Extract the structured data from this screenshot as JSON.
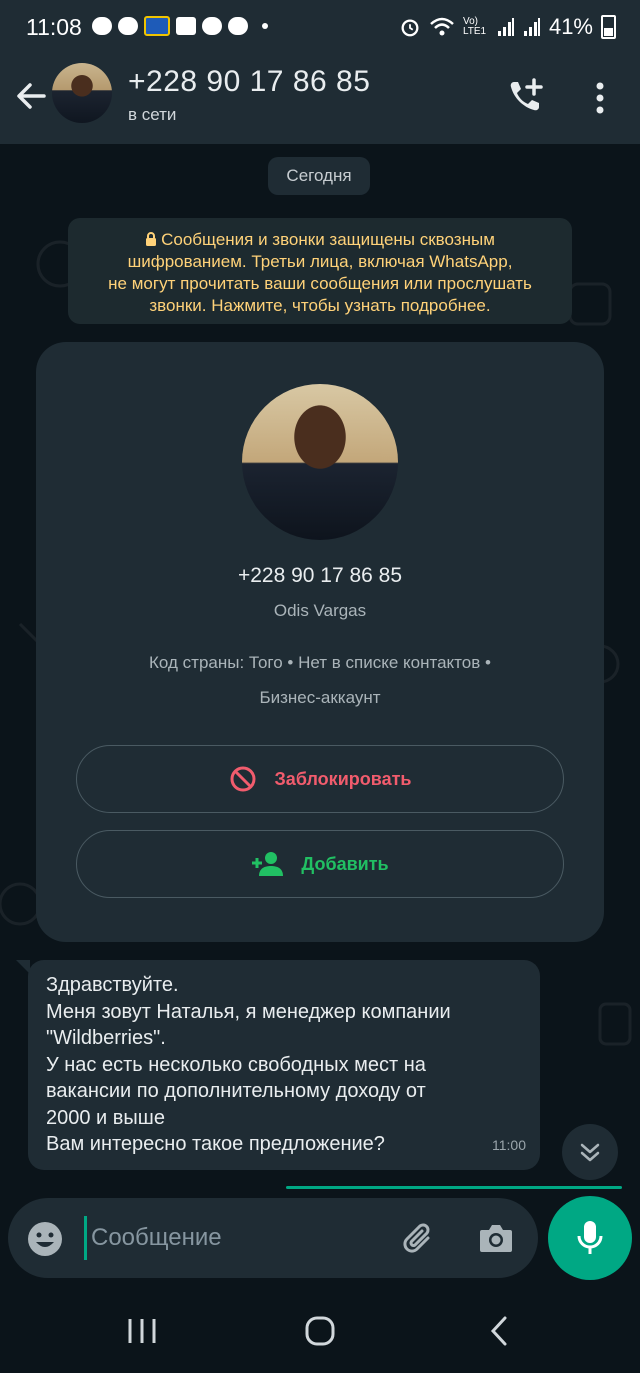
{
  "status_bar": {
    "time": "11:08",
    "battery": "41%",
    "network": "Vo) LTE1",
    "left_icons": [
      "chat-bubble-icon",
      "hh-icon",
      "metro-icon",
      "shopping-bag-icon",
      "cloud-icon",
      "bird-icon",
      "dot-icon"
    ],
    "right_icons": [
      "alarm-icon",
      "wifi-icon",
      "signal-icon",
      "signal-icon",
      "battery-icon"
    ]
  },
  "header": {
    "title": "+228 90 17 86 85",
    "status": "в сети",
    "icons": [
      "back-arrow-icon",
      "add-call-icon",
      "more-vert-icon"
    ]
  },
  "chat": {
    "date_label": "Сегодня",
    "e2e_notice": {
      "lines": [
        "Сообщения и звонки защищены сквозным",
        "шифрованием. Третьи лица, включая WhatsApp,",
        "не могут прочитать ваши сообщения или прослушать",
        "звонки. Нажмите, чтобы узнать подробнее."
      ],
      "icon": "lock-icon"
    },
    "contact_card": {
      "phone": "+228 90 17 86 85",
      "name": "Odis Vargas",
      "info_line1": "Код страны: Того • Нет в списке контактов •",
      "info_line2": "Бизнес-аккаунт",
      "block_label": "Заблокировать",
      "add_label": "Добавить"
    },
    "message": {
      "lines": [
        "Здравствуйте.",
        "Меня зовут Наталья, я менеджер компании",
        "\"Wildberries\".",
        "У нас есть несколько свободных мест на",
        "вакансии по дополнительному доходу от",
        "2000 и выше",
        "Вам интересно такое предложение?"
      ],
      "time": "11:00"
    }
  },
  "input": {
    "placeholder": "Сообщение",
    "value": ""
  },
  "colors": {
    "accent": "#00a884",
    "background": "#0b141a",
    "bar": "#1f2c34",
    "block": "#f15c6d",
    "add": "#21c063",
    "notice": "#ffd279"
  }
}
